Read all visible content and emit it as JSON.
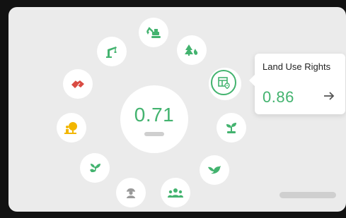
{
  "score": "0.71",
  "tooltip": {
    "title": "Land Use Rights",
    "value": "0.86"
  },
  "colors": {
    "green": "#43b36f",
    "red": "#d94b42",
    "yellow": "#f2b600",
    "gray": "#9a9a9a"
  },
  "icons": [
    "excavator-icon",
    "trees-fire-icon",
    "land-use-map-icon",
    "sprout-icon",
    "bird-icon",
    "community-icon",
    "worker-icon",
    "hand-plant-icon",
    "person-tree-icon",
    "handshake-icon",
    "crane-icon"
  ]
}
